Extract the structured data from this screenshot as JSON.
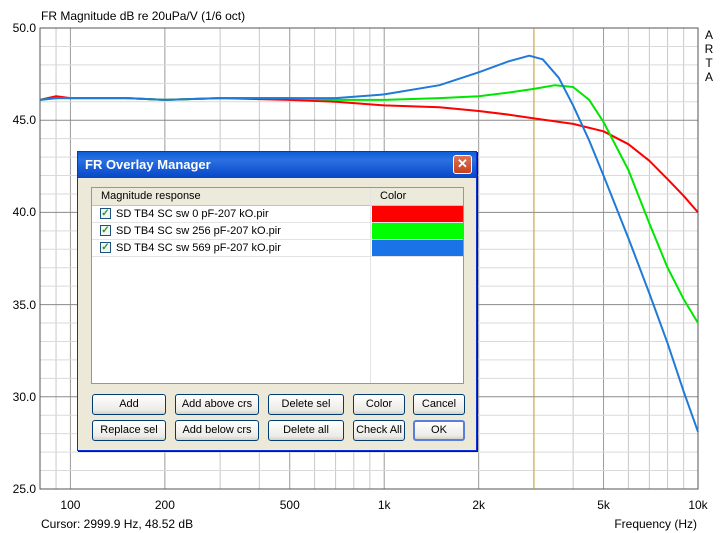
{
  "chart_data": {
    "type": "line",
    "title": "FR Magnitude dB re 20uPa/V (1/6 oct)",
    "xlabel": "Frequency (Hz)",
    "ylabel": "",
    "xscale": "log",
    "xlim": [
      80,
      10000
    ],
    "ylim": [
      25.0,
      50.0
    ],
    "yticks": [
      "50.0",
      "45.0",
      "40.0",
      "35.0",
      "30.0",
      "25.0"
    ],
    "xticks": [
      "100",
      "200",
      "500",
      "1k",
      "2k",
      "5k",
      "10k"
    ],
    "cursor_x": 2999.9,
    "grid": true,
    "series": [
      {
        "name": "SD TB4 SC sw 0 pF-207 kO.pir",
        "color": "#ff0000",
        "x": [
          80,
          90,
          100,
          150,
          200,
          300,
          500,
          700,
          1000,
          1500,
          2000,
          2500,
          3000,
          4000,
          5000,
          6000,
          7000,
          8000,
          9000,
          10000
        ],
        "y": [
          46.1,
          46.3,
          46.2,
          46.2,
          46.1,
          46.2,
          46.1,
          46.0,
          45.8,
          45.7,
          45.5,
          45.3,
          45.1,
          44.8,
          44.4,
          43.7,
          42.8,
          41.8,
          40.9,
          40.0
        ]
      },
      {
        "name": "SD TB4 SC sw 256 pF-207 kO.pir",
        "color": "#00e600",
        "x": [
          80,
          90,
          100,
          150,
          200,
          300,
          500,
          700,
          1000,
          1500,
          2000,
          2500,
          3000,
          3500,
          4000,
          4500,
          5000,
          6000,
          7000,
          8000,
          9000,
          10000
        ],
        "y": [
          46.1,
          46.2,
          46.2,
          46.2,
          46.1,
          46.2,
          46.2,
          46.1,
          46.1,
          46.2,
          46.3,
          46.5,
          46.7,
          46.9,
          46.8,
          46.1,
          44.9,
          42.3,
          39.4,
          37.0,
          35.3,
          34.0
        ]
      },
      {
        "name": "SD TB4 SC sw 569 pF-207 kO.pir",
        "color": "#1f7ad9",
        "x": [
          80,
          90,
          100,
          150,
          200,
          300,
          500,
          700,
          1000,
          1500,
          2000,
          2500,
          2900,
          3200,
          3600,
          4000,
          4500,
          5000,
          6000,
          7000,
          8000,
          9000,
          10000
        ],
        "y": [
          46.1,
          46.2,
          46.2,
          46.2,
          46.1,
          46.2,
          46.2,
          46.2,
          46.4,
          46.9,
          47.6,
          48.2,
          48.5,
          48.3,
          47.3,
          45.8,
          43.9,
          42.0,
          38.6,
          35.6,
          32.9,
          30.3,
          28.1
        ]
      }
    ]
  },
  "side_text": "ARTA",
  "cursor_readout": "Cursor: 2999.9 Hz, 48.52 dB",
  "dialog": {
    "title": "FR Overlay Manager",
    "close_glyph": "✕",
    "col_magnitude": "Magnitude response",
    "col_color": "Color",
    "check_glyph": "✓",
    "rows": [
      {
        "label": "SD TB4 SC sw 0 pF-207 kO.pir",
        "color": "#ff0000"
      },
      {
        "label": "SD TB4 SC sw 256 pF-207 kO.pir",
        "color": "#00ff00"
      },
      {
        "label": "SD TB4 SC sw 569 pF-207 kO.pir",
        "color": "#1a74e8"
      }
    ],
    "buttons": {
      "add": "Add",
      "add_above": "Add above crs",
      "delete_sel": "Delete sel",
      "color": "Color",
      "cancel": "Cancel",
      "replace_sel": "Replace sel",
      "add_below": "Add below crs",
      "delete_all": "Delete all",
      "check_all": "Check All",
      "ok": "OK"
    }
  }
}
